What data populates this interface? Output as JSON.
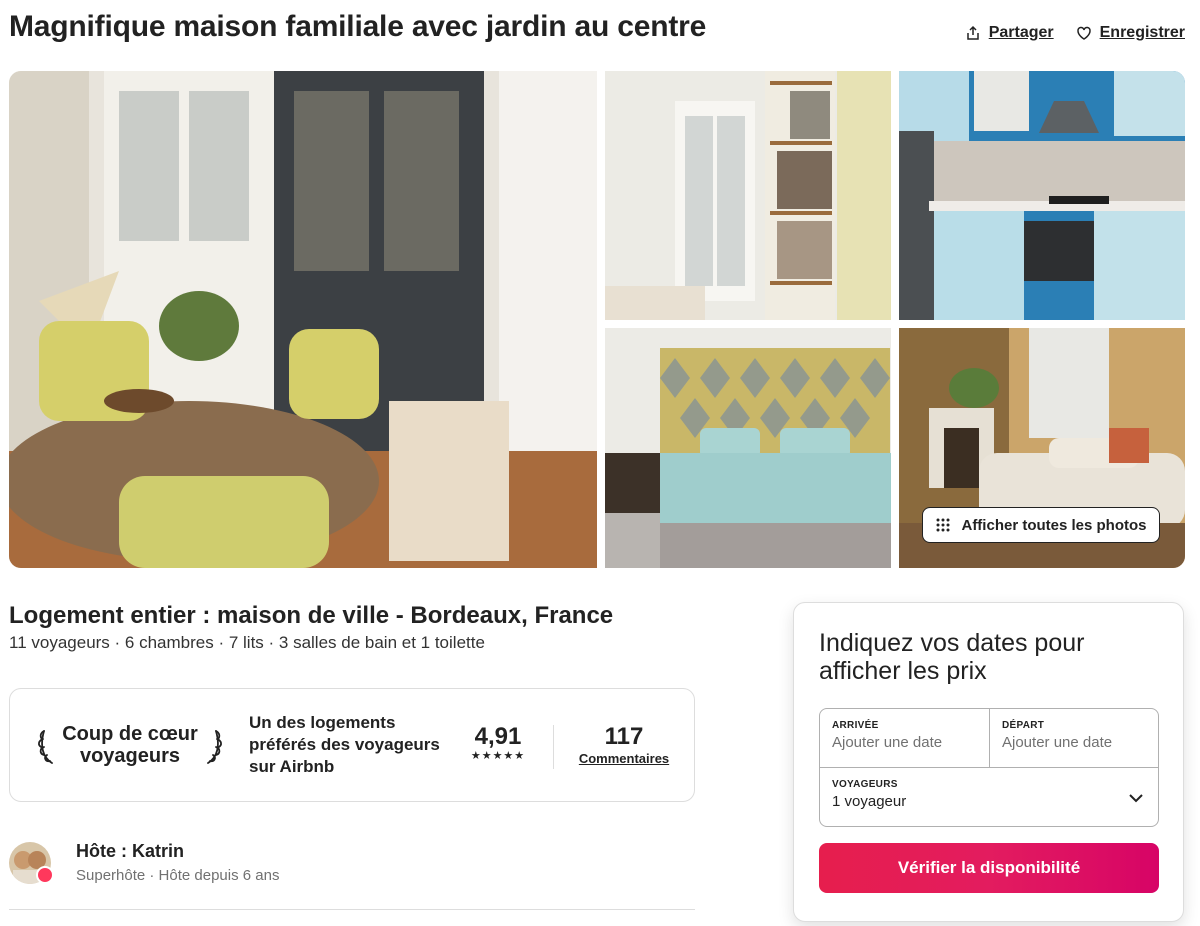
{
  "header": {
    "title": "Magnifique maison familiale avec jardin au centre",
    "share_label": "Partager",
    "save_label": "Enregistrer"
  },
  "gallery": {
    "show_all_label": "Afficher toutes les photos"
  },
  "listing": {
    "subtitle": "Logement entier : maison de ville - Bordeaux, France",
    "details": "11 voyageurs · 6 chambres · 7 lits · 3 salles de bain et 1 toilette"
  },
  "guest_favorite": {
    "badge_line1": "Coup de cœur",
    "badge_line2": "voyageurs",
    "description": "Un des logements préférés des voyageurs sur Airbnb",
    "rating": "4,91",
    "stars": "★★★★★",
    "reviews_count": "117",
    "reviews_label": "Commentaires"
  },
  "host": {
    "name": "Hôte : Katrin",
    "subtitle": "Superhôte · Hôte depuis 6 ans"
  },
  "booking": {
    "title": "Indiquez vos dates pour afficher les prix",
    "checkin_label": "ARRIVÉE",
    "checkin_placeholder": "Ajouter une date",
    "checkout_label": "DÉPART",
    "checkout_placeholder": "Ajouter une date",
    "guests_label": "VOYAGEURS",
    "guests_value": "1 voyageur",
    "cta_label": "Vérifier la disponibilité"
  },
  "colors": {
    "brand": "#e31c5f",
    "superhost_badge": "#ff385c",
    "text": "#222222",
    "muted": "#717171"
  }
}
